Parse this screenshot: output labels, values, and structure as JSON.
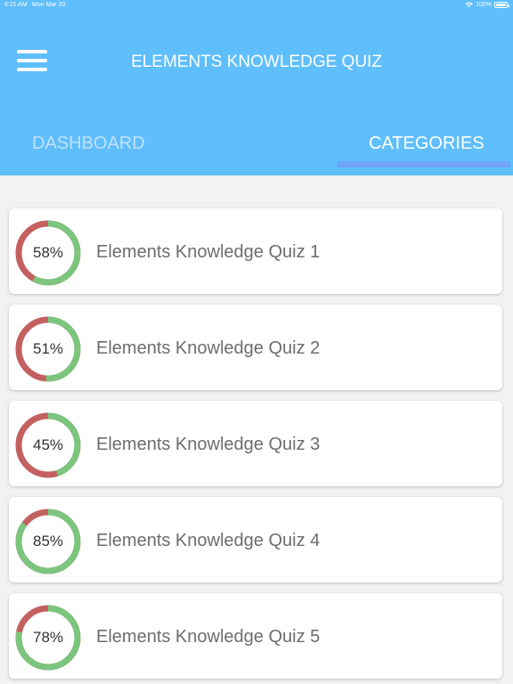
{
  "status_bar": {
    "time": "6:21 AM",
    "date": "Mon Mar 20",
    "battery": "100%"
  },
  "header": {
    "title": "ELEMENTS KNOWLEDGE QUIZ",
    "background_color": "#5fbefc"
  },
  "tabs": [
    {
      "label": "DASHBOARD",
      "active": false
    },
    {
      "label": "CATEGORIES",
      "active": true
    }
  ],
  "colors": {
    "correct": "#7cc57f",
    "incorrect": "#c46060",
    "tab_indicator": "#6fa4f4"
  },
  "categories": [
    {
      "title": "Elements Knowledge Quiz 1",
      "percent": 58,
      "percent_label": "58%"
    },
    {
      "title": "Elements Knowledge Quiz 2",
      "percent": 51,
      "percent_label": "51%"
    },
    {
      "title": "Elements Knowledge Quiz 3",
      "percent": 45,
      "percent_label": "45%"
    },
    {
      "title": "Elements Knowledge Quiz 4",
      "percent": 85,
      "percent_label": "85%"
    },
    {
      "title": "Elements Knowledge Quiz 5",
      "percent": 78,
      "percent_label": "78%"
    }
  ]
}
